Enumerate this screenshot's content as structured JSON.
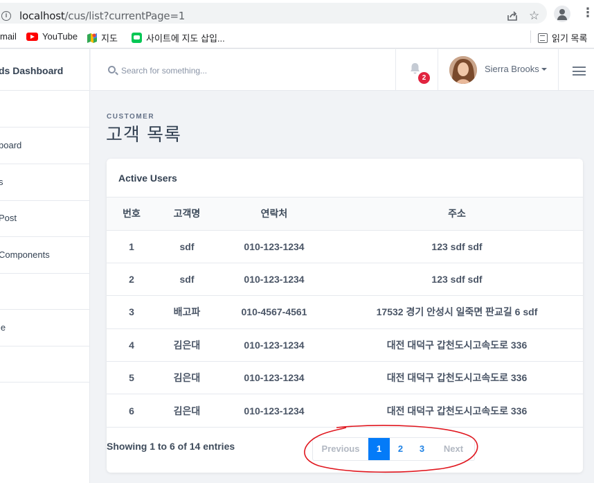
{
  "browser": {
    "url_host": "localhost",
    "url_path": "/cus/list?currentPage=1",
    "bookmarks": [
      {
        "label": "mail",
        "icon": "mail-icon"
      },
      {
        "label": "YouTube",
        "icon": "youtube-icon"
      },
      {
        "label": "지도",
        "icon": "google-maps-icon"
      },
      {
        "label": "사이트에 지도 삽입...",
        "icon": "naver-icon"
      }
    ],
    "reading_list": "읽기 목록"
  },
  "sidebar": {
    "brand": "ds Dashboard",
    "items": [
      {
        "label": ""
      },
      {
        "label": "board"
      },
      {
        "label": "s"
      },
      {
        "label": "Post"
      },
      {
        "label": "Components"
      },
      {
        "label": ""
      },
      {
        "label": "le"
      },
      {
        "label": ""
      }
    ]
  },
  "header": {
    "search_placeholder": "Search for something...",
    "notification_count": "2",
    "user_name": "Sierra Brooks"
  },
  "page": {
    "crumb": "CUSTOMER",
    "title": "고객 목록"
  },
  "card": {
    "title": "Active Users",
    "columns": [
      "번호",
      "고객명",
      "연락처",
      "주소"
    ],
    "rows": [
      [
        "1",
        "sdf",
        "010-123-1234",
        "123 sdf sdf"
      ],
      [
        "2",
        "sdf",
        "010-123-1234",
        "123 sdf sdf"
      ],
      [
        "3",
        "배고파",
        "010-4567-4561",
        "17532 경기 안성시 일죽면 판교길 6 sdf"
      ],
      [
        "4",
        "김은대",
        "010-123-1234",
        "대전 대덕구 갑천도시고속도로 336"
      ],
      [
        "5",
        "김은대",
        "010-123-1234",
        "대전 대덕구 갑천도시고속도로 336"
      ],
      [
        "6",
        "김은대",
        "010-123-1234",
        "대전 대덕구 갑천도시고속도로 336"
      ]
    ],
    "showing": "Showing 1 to 6 of 14 entries",
    "pagination": {
      "previous": "Previous",
      "pages": [
        "1",
        "2",
        "3"
      ],
      "active": "1",
      "next": "Next"
    }
  },
  "colors": {
    "accent": "#047bf8",
    "badge": "#e1243f",
    "annotation": "#e0161e"
  }
}
